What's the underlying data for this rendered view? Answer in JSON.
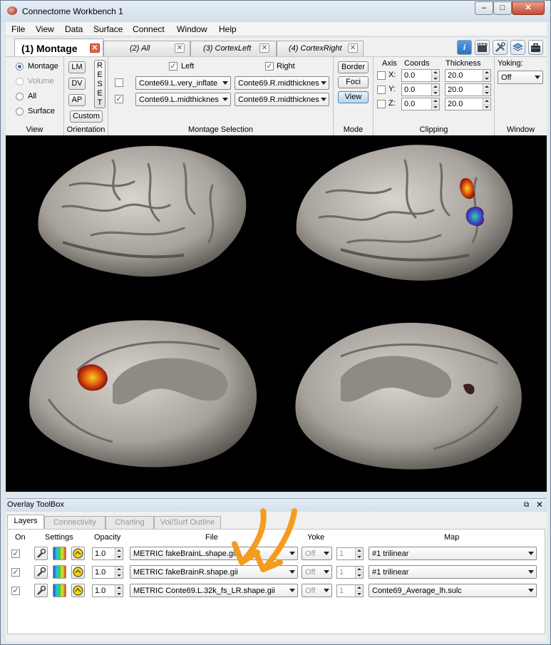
{
  "window": {
    "title": "Connectome Workbench 1",
    "minimize_glyph": "–",
    "maximize_glyph": "□",
    "close_glyph": "✕"
  },
  "menu": [
    "File",
    "View",
    "Data",
    "Surface",
    "Connect",
    "Window",
    "Help"
  ],
  "tabs": [
    {
      "label": "(1) Montage",
      "active": true
    },
    {
      "label": "(2) All",
      "active": false
    },
    {
      "label": "(3) CortexLeft",
      "active": false
    },
    {
      "label": "(4) CortexRight",
      "active": false
    }
  ],
  "tab_close_glyph": "✕",
  "toolbar_icons": [
    "info-icon",
    "movie-icon",
    "tools-icon",
    "layers-icon",
    "briefcase-icon"
  ],
  "view_panel": {
    "title": "View",
    "options": [
      {
        "label": "Montage",
        "selected": true,
        "enabled": true
      },
      {
        "label": "Volume",
        "selected": false,
        "enabled": false
      },
      {
        "label": "All",
        "selected": false,
        "enabled": true
      },
      {
        "label": "Surface",
        "selected": false,
        "enabled": true
      }
    ]
  },
  "orientation_panel": {
    "title": "Orientation",
    "buttons": [
      "LM",
      "DV",
      "AP"
    ],
    "reset_letters": [
      "R",
      "E",
      "S",
      "E",
      "T"
    ],
    "custom": "Custom"
  },
  "montage_panel": {
    "title": "Montage Selection",
    "left_label": "Left",
    "right_label": "Right",
    "left_checked": true,
    "right_checked": true,
    "rows": [
      {
        "checked": false,
        "left": "Conte69.L.very_inflate",
        "right": "Conte69.R.midthicknes"
      },
      {
        "checked": true,
        "left": "Conte69.L.midthicknes",
        "right": "Conte69.R.midthicknes"
      }
    ]
  },
  "mode_panel": {
    "title": "Mode",
    "buttons": [
      {
        "label": "Border",
        "active": false
      },
      {
        "label": "Foci",
        "active": false
      },
      {
        "label": "View",
        "active": true
      }
    ]
  },
  "clipping_panel": {
    "title": "Clipping",
    "headers": {
      "axis": "Axis",
      "coords": "Coords",
      "thickness": "Thickness"
    },
    "rows": [
      {
        "axis": "X:",
        "coord": "0.0",
        "thickness": "20.0"
      },
      {
        "axis": "Y:",
        "coord": "0.0",
        "thickness": "20.0"
      },
      {
        "axis": "Z:",
        "coord": "0.0",
        "thickness": "20.0"
      }
    ]
  },
  "window_panel": {
    "title": "Window",
    "yoking_label": "Yoking:",
    "yoking_value": "Off"
  },
  "overlay_toolbox": {
    "title": "Overlay ToolBox",
    "tabs": [
      {
        "label": "Layers",
        "active": true
      },
      {
        "label": "Connectivity",
        "active": false
      },
      {
        "label": "Charting",
        "active": false
      },
      {
        "label": "Vol/Surf Outline",
        "active": false
      }
    ],
    "headers": {
      "on": "On",
      "settings": "Settings",
      "opacity": "Opacity",
      "file": "File",
      "yoke": "Yoke",
      "map": "Map"
    },
    "layers": [
      {
        "on": true,
        "opacity": "1.0",
        "file": "METRIC fakeBrainL.shape.gii",
        "yoke": "Off",
        "map_index": "1",
        "map": "#1 trilinear"
      },
      {
        "on": true,
        "opacity": "1.0",
        "file": "METRIC fakeBrainR.shape.gii",
        "yoke": "Off",
        "map_index": "1",
        "map": "#1 trilinear"
      },
      {
        "on": true,
        "opacity": "1.0",
        "file": "METRIC Conte69.L.32k_fs_LR.shape.gii",
        "yoke": "Off",
        "map_index": "1",
        "map": "Conte69_Average_lh.sulc"
      }
    ]
  },
  "colors": {
    "accent": "#3a6ea8",
    "annotation_arrow": "#f39c1f",
    "canvas_bg": "#000000",
    "tab_close": "#e8634a"
  }
}
